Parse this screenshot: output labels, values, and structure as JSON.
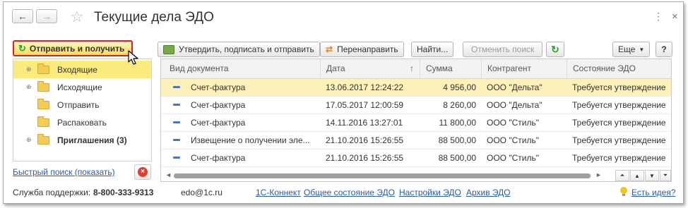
{
  "window": {
    "title": "Текущие дела ЭДО",
    "back_icon": "←",
    "forward_icon": "→",
    "star_icon": "☆",
    "menu_icon": "⋮",
    "close_icon": "×"
  },
  "left_panel": {
    "send_button": "Отправить и получить",
    "tree": [
      {
        "label": "Входящие",
        "expandable": true,
        "selected": true,
        "bold": false
      },
      {
        "label": "Исходящие",
        "expandable": true,
        "selected": false,
        "bold": false
      },
      {
        "label": "Отправить",
        "expandable": false,
        "selected": false,
        "bold": false
      },
      {
        "label": "Распаковать",
        "expandable": false,
        "selected": false,
        "bold": false
      },
      {
        "label": "Приглашения (3)",
        "expandable": true,
        "selected": false,
        "bold": true
      }
    ],
    "quick_search": "Быстрый поиск (показать)"
  },
  "toolbar": {
    "approve_sign_send": "Утвердить, подписать и отправить",
    "redirect": "Перенаправить",
    "find": "Найти...",
    "cancel_search": "Отменить поиск",
    "refresh_icon": "↻",
    "more": "Еще",
    "help": "?"
  },
  "table": {
    "columns": [
      "Вид документа",
      "Дата",
      "Сумма",
      "Контрагент",
      "Состояние ЭДО"
    ],
    "sort_indicator": "↑",
    "rows": [
      {
        "doc": "Счет-фактура",
        "date": "13.06.2017 12:24:22",
        "sum": "4 956,00",
        "partner": "ООО \"Дельта\"",
        "state": "Требуется утверждение",
        "selected": true
      },
      {
        "doc": "Счет-фактура",
        "date": "17.05.2017 12:00:59",
        "sum": "8 260,00",
        "partner": "ООО \"Дельта\"",
        "state": "Требуется утверждение",
        "selected": false
      },
      {
        "doc": "Счет-фактура",
        "date": "14.11.2016 13:27:01",
        "sum": "11 800,00",
        "partner": "ООО \"Стиль\"",
        "state": "Требуется утверждение",
        "selected": false
      },
      {
        "doc": "Извещение о получении эле...",
        "date": "21.10.2016 15:26:55",
        "sum": "88 500,00",
        "partner": "ООО \"Стиль\"",
        "state": "Требуется утверждение",
        "selected": false
      },
      {
        "doc": "Счет-фактура",
        "date": "21.10.2016 15:26:55",
        "sum": "88 500,00",
        "partner": "ООО \"Стиль\"",
        "state": "Требуется утверждение",
        "selected": false
      }
    ]
  },
  "footer": {
    "support_label": "Служба поддержки:",
    "support_phone": "8-800-333-9313",
    "email": "edo@1c.ru",
    "links": [
      "1С-Коннект",
      "Общее состояние ЭДО",
      "Настройки ЭДО",
      "Архив ЭДО"
    ],
    "idea_link": "Есть идея?"
  },
  "colors": {
    "selection": "#fbeb7c",
    "row_selection": "#fbf1b9",
    "link": "#2a5ca8",
    "highlight_border": "#e02020"
  }
}
